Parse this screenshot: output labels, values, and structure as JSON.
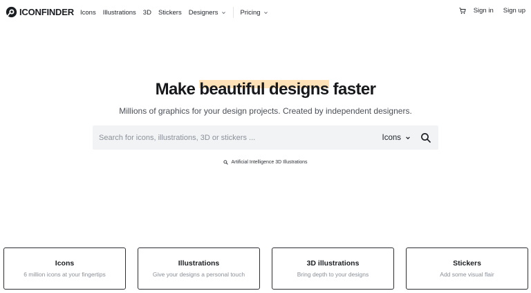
{
  "header": {
    "logo_text": "ICONFINDER",
    "nav": [
      {
        "label": "Icons"
      },
      {
        "label": "Illustrations"
      },
      {
        "label": "3D"
      },
      {
        "label": "Stickers"
      },
      {
        "label": "Designers"
      }
    ],
    "pricing_label": "Pricing",
    "signin_label": "Sign in",
    "signup_label": "Sign up"
  },
  "hero": {
    "title_part1": "Make ",
    "title_highlight": "beautiful designs",
    "title_part2": " faster",
    "subtitle": "Millions of graphics for your design projects. Created by independent designers.",
    "highlight_color": "#ffe2b8"
  },
  "search": {
    "placeholder": "Search for icons, illustrations, 3D or stickers ...",
    "value": "",
    "type_label": "Icons",
    "suggestion": "Artificial Intelligence 3D Illustrations"
  },
  "cards": [
    {
      "title": "Icons",
      "desc": "6 million icons at your fingertips"
    },
    {
      "title": "Illustrations",
      "desc": "Give your designs a personal touch"
    },
    {
      "title": "3D illustrations",
      "desc": "Bring depth to your designs"
    },
    {
      "title": "Stickers",
      "desc": "Add some visual flair"
    }
  ],
  "icons": {
    "logo": "iconfinder-logo-icon",
    "cart": "cart-icon",
    "search": "search-icon",
    "chevron": "chevron-down-icon"
  }
}
